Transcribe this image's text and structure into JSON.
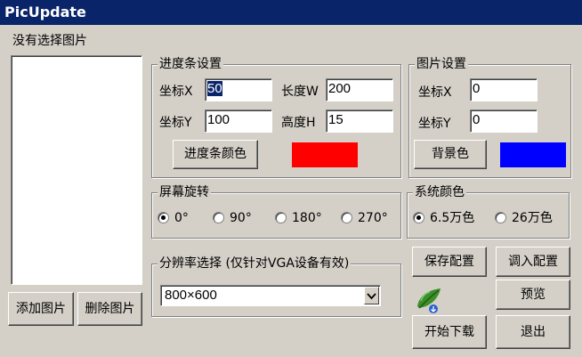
{
  "window": {
    "title": "PicUpdate"
  },
  "list": {
    "label": "没有选择图片"
  },
  "buttons": {
    "add": "添加图片",
    "delete": "删除图片",
    "save_config": "保存配置",
    "load_config": "调入配置",
    "preview": "预览",
    "start_download": "开始下载",
    "exit": "退出"
  },
  "progress": {
    "group_label": "进度条设置",
    "x_label": "坐标X",
    "x_value": "50",
    "w_label": "长度W",
    "w_value": "200",
    "y_label": "坐标Y",
    "y_value": "100",
    "h_label": "高度H",
    "h_value": "15",
    "color_button": "进度条颜色",
    "color": "#ff0000"
  },
  "picture": {
    "group_label": "图片设置",
    "x_label": "坐标X",
    "x_value": "0",
    "y_label": "坐标Y",
    "y_value": "0",
    "bg_button": "背景色",
    "bg_color": "#0000ff"
  },
  "rotation": {
    "group_label": "屏幕旋转",
    "options": [
      "0°",
      "90°",
      "180°",
      "270°"
    ],
    "selected": "0°"
  },
  "system_color": {
    "group_label": "系统颜色",
    "options": [
      "6.5万色",
      "26万色"
    ],
    "selected": "6.5万色"
  },
  "resolution": {
    "group_label": "分辨率选择 (仅针对VGA设备有效)",
    "value": "800×600"
  },
  "icons": {
    "download": "leaf-download-icon",
    "dropdown": "chevron-down-icon"
  }
}
